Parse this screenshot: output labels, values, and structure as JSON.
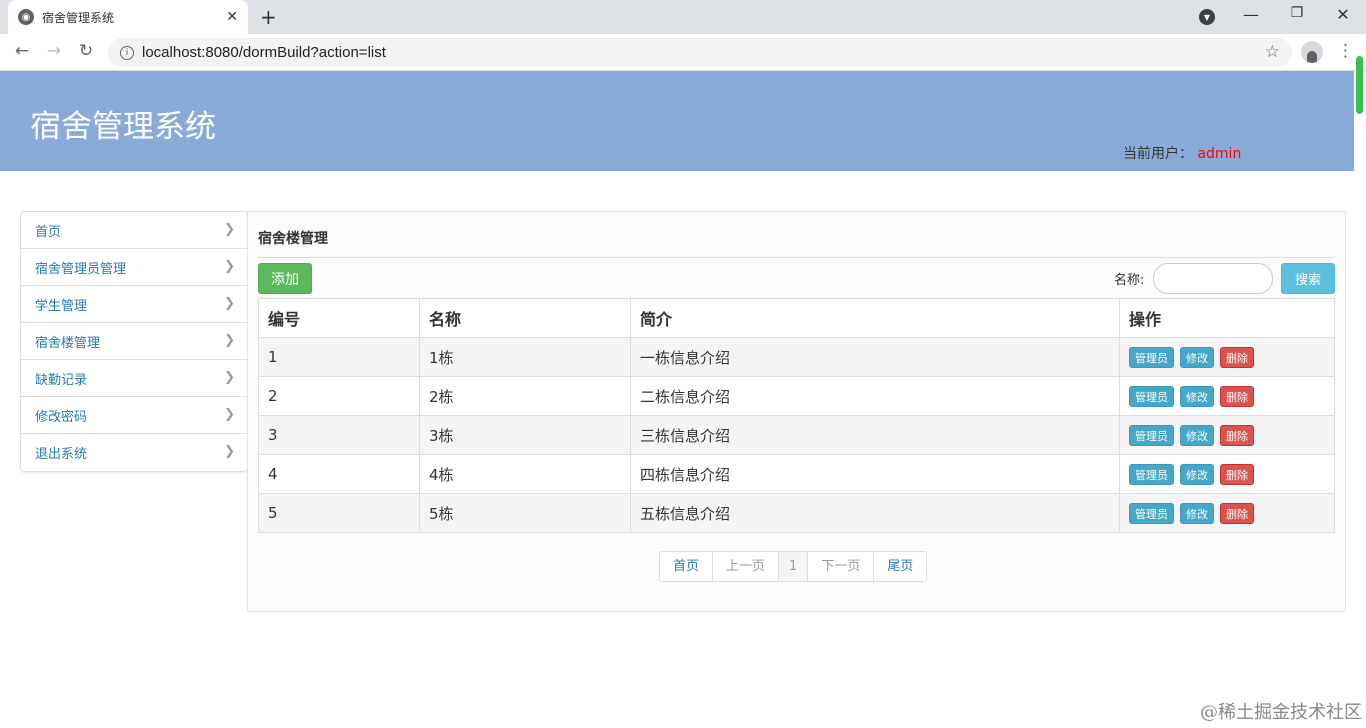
{
  "browser": {
    "tab_title": "宿舍管理系统",
    "url": "localhost:8080/dormBuild?action=list",
    "icons": [
      "favicon-globe-icon",
      "close-icon",
      "new-tab-icon",
      "minimize-icon",
      "restore-icon",
      "close-window-icon",
      "back-icon",
      "forward-icon",
      "reload-icon",
      "site-info-icon",
      "star-icon",
      "account-icon",
      "menu-icon"
    ]
  },
  "header": {
    "title": "宿舍管理系统",
    "user_label": "当前用户：",
    "user_name": "admin"
  },
  "sidebar": {
    "items": [
      {
        "label": "首页"
      },
      {
        "label": "宿舍管理员管理"
      },
      {
        "label": "学生管理"
      },
      {
        "label": "宿舍楼管理"
      },
      {
        "label": "缺勤记录"
      },
      {
        "label": "修改密码"
      },
      {
        "label": "退出系统"
      }
    ]
  },
  "main": {
    "title": "宿舍楼管理",
    "add_label": "添加",
    "search_label": "名称:",
    "search_value": "",
    "search_button": "搜索",
    "columns": [
      "编号",
      "名称",
      "简介",
      "操作"
    ],
    "actions": {
      "manager": "管理员",
      "edit": "修改",
      "delete": "删除"
    },
    "rows": [
      {
        "id": "1",
        "name": "1栋",
        "desc": "一栋信息介绍"
      },
      {
        "id": "2",
        "name": "2栋",
        "desc": "二栋信息介绍"
      },
      {
        "id": "3",
        "name": "3栋",
        "desc": "三栋信息介绍"
      },
      {
        "id": "4",
        "name": "4栋",
        "desc": "四栋信息介绍"
      },
      {
        "id": "5",
        "name": "5栋",
        "desc": "五栋信息介绍"
      }
    ],
    "pagination": {
      "first": "首页",
      "prev": "上一页",
      "current": "1",
      "next": "下一页",
      "last": "尾页"
    }
  },
  "watermark": "@稀土掘金技术社区",
  "colors": {
    "header_bg": "#89abd9",
    "link": "#2a7ab5",
    "success": "#5cb85c",
    "info": "#5bc0de",
    "danger": "#d9534f",
    "user_name": "#ff0000"
  }
}
